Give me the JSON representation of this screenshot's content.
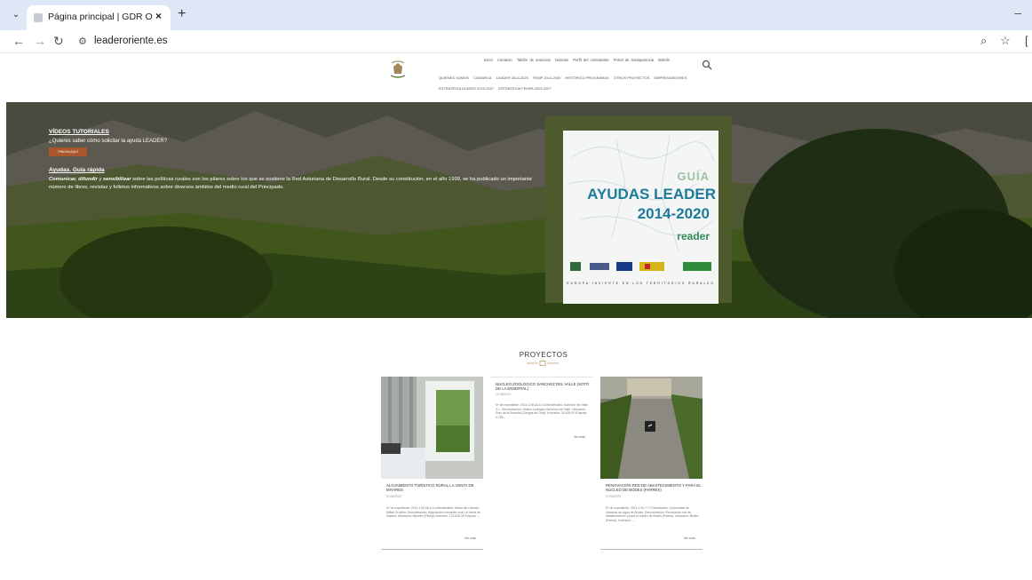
{
  "browser": {
    "tab_title": "Página principal | GDR Oriente",
    "url": "leaderoriente.es"
  },
  "nav": {
    "top": [
      "Inicio",
      "Contacto",
      "Tablón de anuncios",
      "Noticias",
      "Perfil del contratante",
      "Portal de transparencia",
      "Boletín"
    ],
    "sub": [
      "QUIÉNES SOMOS",
      "COMARCA",
      "LEADER 2014-2020",
      "FEMP 2014-2020",
      "HISTÓRICO PROGRAMAS",
      "OTROS PROYECTOS",
      "EMPRENDEDORES"
    ],
    "sub2": [
      "ESTRATEGIA LEADER 2023-2027",
      "ESTRATEGIA FEMPA 2023-2027"
    ]
  },
  "hero": {
    "videos_link": "VÍDEOS TUTORIALES",
    "question": "¿Quieres saber cómo solicitar la ayuda LEADER?",
    "button": "PINCHA AQUÍ",
    "guide_link": "Ayudas. Guía rápida",
    "desc_em": "Comunicar, difundir",
    "desc_mid": " y ",
    "desc_em2": "sensibilizar",
    "desc_rest": " sobre las políticas rurales son los pilares sobre los que se sostiene la Red Asturiana de Desarrollo Rural. Desde su constitución, en el año 1999, se ha publicado un importante número de libros, revistas y folletos informativos sobre diversos ámbitos del medio rural del Principado.",
    "guide_cover": {
      "guia": "GUÍA",
      "title1": "AYUDAS LEADER",
      "title2": "2014-2020",
      "brand": "reader",
      "footer": "EUROPA INVIERTE EN LOS TERRITORIOS RURALES"
    }
  },
  "projects": {
    "title": "PROYECTOS",
    "cards": [
      {
        "title": "ALOJAMIENTO TURÍSTICO RURAL LA VENTA DE MIYARES",
        "date": "21/06/2023",
        "desc": "Nº de expediente: 2014.1.06.6A.6.4.a Beneficiario: María del Carmen Millán Ordóñez Denominación: Adquisición inmueble rural La Venta de Miyares Ubicación: Miyares (Piloña) Inversión: 175.626,39 € Ayuda ...",
        "more": "Ver más"
      },
      {
        "title": "NÚCLEO ZOOLÓGICO SANCHEZ DEL VALLE (SOTO DE LA ENSERTAL)",
        "date": "21/06/2023",
        "desc": "Nº de expediente: 2014.1.06.6A.6.4.a Beneficiario: Sánchez del Valle S.L. Denominación: Núcleo zoológico Sánchez del Valle. Ubicación: Soto de la Ensertal (Cangas de Onís). Inversión: 34.005,00 € Ayuda: 9.796...",
        "more": "Ver más"
      },
      {
        "title": "RENOVACIÓN RED DE ABASTECIMIENTO Y PARA EL NÚCLEO DE BODES (PARRES)",
        "date": "21/06/2023",
        "desc": "Nº de expediente: 2014.1.06.7.7.2 Beneficiario: Comunidad de Usuarios de Agua de Bodes. Denominación: Renovación red de abastecimiento y para el núcleo de Bodes (Parres). Ubicación: Bodes (Parres). Inversión: ...",
        "more": "Ver más"
      }
    ]
  }
}
